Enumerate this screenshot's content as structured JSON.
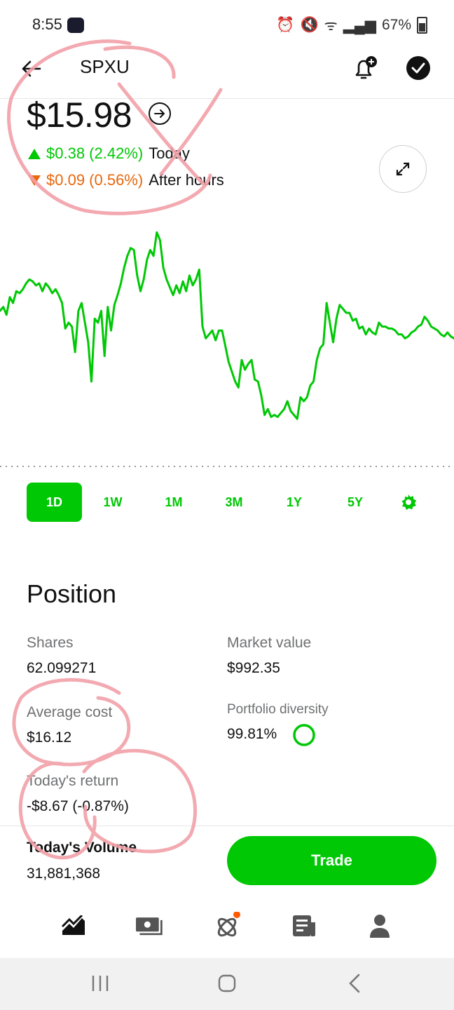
{
  "status_bar": {
    "time": "8:55",
    "battery": "67%"
  },
  "header": {
    "ticker": "SPXU"
  },
  "quote": {
    "price": "$15.98",
    "today_change": "$0.38 (2.42%)",
    "today_label": "Today",
    "after_change": "$0.09 (0.56%)",
    "after_label": "After hours"
  },
  "colors": {
    "up": "#00c805",
    "down": "#e8670c",
    "annotation": "#f2a0a8"
  },
  "chart_data": {
    "type": "line",
    "series": [
      {
        "values": [
          15.56,
          15.58,
          15.54,
          15.63,
          15.6,
          15.66,
          15.65,
          15.67,
          15.7,
          15.72,
          15.71,
          15.69,
          15.7,
          15.66,
          15.7,
          15.68,
          15.65,
          15.67,
          15.64,
          15.6,
          15.47,
          15.5,
          15.48,
          15.35,
          15.56,
          15.6,
          15.5,
          15.4,
          15.2,
          15.52,
          15.5,
          15.56,
          15.33,
          15.58,
          15.46,
          15.59,
          15.64,
          15.7,
          15.78,
          15.84,
          15.88,
          15.87,
          15.74,
          15.66,
          15.72,
          15.82,
          15.87,
          15.84,
          15.96,
          15.92,
          15.78,
          15.72,
          15.68,
          15.64,
          15.69,
          15.65,
          15.71,
          15.66,
          15.74,
          15.69,
          15.72,
          15.77,
          15.48,
          15.42,
          15.44,
          15.46,
          15.41,
          15.46,
          15.46,
          15.38,
          15.3,
          15.25,
          15.2,
          15.17,
          15.31,
          15.26,
          15.29,
          15.31,
          15.21,
          15.2,
          15.13,
          15.03,
          15.06,
          15.02,
          15.03,
          15.02,
          15.04,
          15.06,
          15.1,
          15.05,
          15.03,
          15.01,
          15.12,
          15.1,
          15.12,
          15.18,
          15.2,
          15.31,
          15.37,
          15.39,
          15.6,
          15.5,
          15.4,
          15.52,
          15.59,
          15.57,
          15.55,
          15.55,
          15.51,
          15.52,
          15.47,
          15.48,
          15.44,
          15.47,
          15.45,
          15.44,
          15.5,
          15.48,
          15.48,
          15.47,
          15.47,
          15.46,
          15.44,
          15.44,
          15.42,
          15.43,
          15.45,
          15.46,
          15.48,
          15.49,
          15.53,
          15.51,
          15.48,
          15.47,
          15.46,
          15.44,
          15.43,
          15.45,
          15.43,
          15.42
        ]
      }
    ]
  },
  "range_tabs": [
    "1D",
    "1W",
    "1M",
    "3M",
    "1Y",
    "5Y"
  ],
  "position": {
    "title": "Position",
    "shares_label": "Shares",
    "shares": "62.099271",
    "market_value_label": "Market value",
    "market_value": "$992.35",
    "avg_cost_label": "Average cost",
    "avg_cost": "$16.12",
    "diversity_label": "Portfolio diversity",
    "diversity": "99.81%",
    "diversity_fraction": 0.9981,
    "return_label": "Today's return",
    "return": "-$8.67 (-0.87%)",
    "volume_label": "Today's Volume",
    "volume": "31,881,368"
  },
  "trade_button": "Trade",
  "nav": {
    "icons": [
      "investing-icon",
      "cash-icon",
      "crypto-icon",
      "news-icon",
      "account-icon"
    ]
  }
}
